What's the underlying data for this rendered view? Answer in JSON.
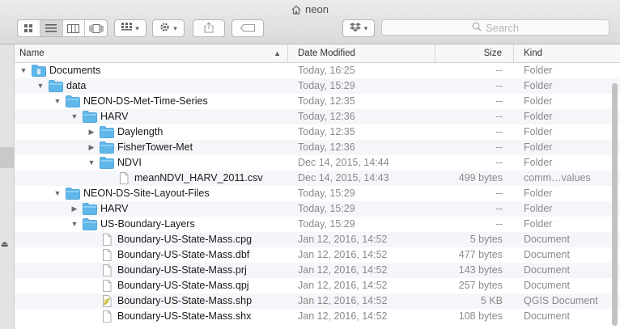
{
  "window": {
    "title": "neon"
  },
  "toolbar": {
    "view_buttons": [
      "icon-view-icon",
      "list-view-icon",
      "column-view-icon",
      "coverflow-view-icon"
    ],
    "active_view": 1,
    "search_placeholder": "Search"
  },
  "columns": {
    "name": "Name",
    "date": "Date Modified",
    "size": "Size",
    "kind": "Kind"
  },
  "rows": [
    {
      "level": 0,
      "disclosure": "open",
      "icon": "doc-folder",
      "name": "Documents",
      "date": "Today, 16:25",
      "size": "--",
      "kind": "Folder"
    },
    {
      "level": 1,
      "disclosure": "open",
      "icon": "folder",
      "name": "data",
      "date": "Today, 15:29",
      "size": "--",
      "kind": "Folder"
    },
    {
      "level": 2,
      "disclosure": "open",
      "icon": "folder",
      "name": "NEON-DS-Met-Time-Series",
      "date": "Today, 12:35",
      "size": "--",
      "kind": "Folder"
    },
    {
      "level": 3,
      "disclosure": "open",
      "icon": "folder",
      "name": "HARV",
      "date": "Today, 12:36",
      "size": "--",
      "kind": "Folder"
    },
    {
      "level": 4,
      "disclosure": "closed",
      "icon": "folder",
      "name": "Daylength",
      "date": "Today, 12:35",
      "size": "--",
      "kind": "Folder"
    },
    {
      "level": 4,
      "disclosure": "closed",
      "icon": "folder",
      "name": "FisherTower-Met",
      "date": "Today, 12:36",
      "size": "--",
      "kind": "Folder"
    },
    {
      "level": 4,
      "disclosure": "open",
      "icon": "folder",
      "name": "NDVI",
      "date": "Dec 14, 2015, 14:44",
      "size": "--",
      "kind": "Folder"
    },
    {
      "level": 5,
      "disclosure": "none",
      "icon": "file",
      "name": "meanNDVI_HARV_2011.csv",
      "date": "Dec 14, 2015, 14:43",
      "size": "499 bytes",
      "kind": "comm…values"
    },
    {
      "level": 2,
      "disclosure": "open",
      "icon": "folder",
      "name": "NEON-DS-Site-Layout-Files",
      "date": "Today, 15:29",
      "size": "--",
      "kind": "Folder"
    },
    {
      "level": 3,
      "disclosure": "closed",
      "icon": "folder",
      "name": "HARV",
      "date": "Today, 15:29",
      "size": "--",
      "kind": "Folder"
    },
    {
      "level": 3,
      "disclosure": "open",
      "icon": "folder",
      "name": "US-Boundary-Layers",
      "date": "Today, 15:29",
      "size": "--",
      "kind": "Folder"
    },
    {
      "level": 4,
      "disclosure": "none",
      "icon": "file",
      "name": "Boundary-US-State-Mass.cpg",
      "date": "Jan 12, 2016, 14:52",
      "size": "5 bytes",
      "kind": "Document"
    },
    {
      "level": 4,
      "disclosure": "none",
      "icon": "file",
      "name": "Boundary-US-State-Mass.dbf",
      "date": "Jan 12, 2016, 14:52",
      "size": "477 bytes",
      "kind": "Document"
    },
    {
      "level": 4,
      "disclosure": "none",
      "icon": "file",
      "name": "Boundary-US-State-Mass.prj",
      "date": "Jan 12, 2016, 14:52",
      "size": "143 bytes",
      "kind": "Document"
    },
    {
      "level": 4,
      "disclosure": "none",
      "icon": "file",
      "name": "Boundary-US-State-Mass.qpj",
      "date": "Jan 12, 2016, 14:52",
      "size": "257 bytes",
      "kind": "Document"
    },
    {
      "level": 4,
      "disclosure": "none",
      "icon": "qgis-file",
      "name": "Boundary-US-State-Mass.shp",
      "date": "Jan 12, 2016, 14:52",
      "size": "5 KB",
      "kind": "QGIS Document"
    },
    {
      "level": 4,
      "disclosure": "none",
      "icon": "file",
      "name": "Boundary-US-State-Mass.shx",
      "date": "Jan 12, 2016, 14:52",
      "size": "108 bytes",
      "kind": "Document"
    }
  ],
  "colors": {
    "folder": "#5fb7ea",
    "folder_tab": "#8ccdf2",
    "selection_sidebar": "#c9c9c9"
  }
}
